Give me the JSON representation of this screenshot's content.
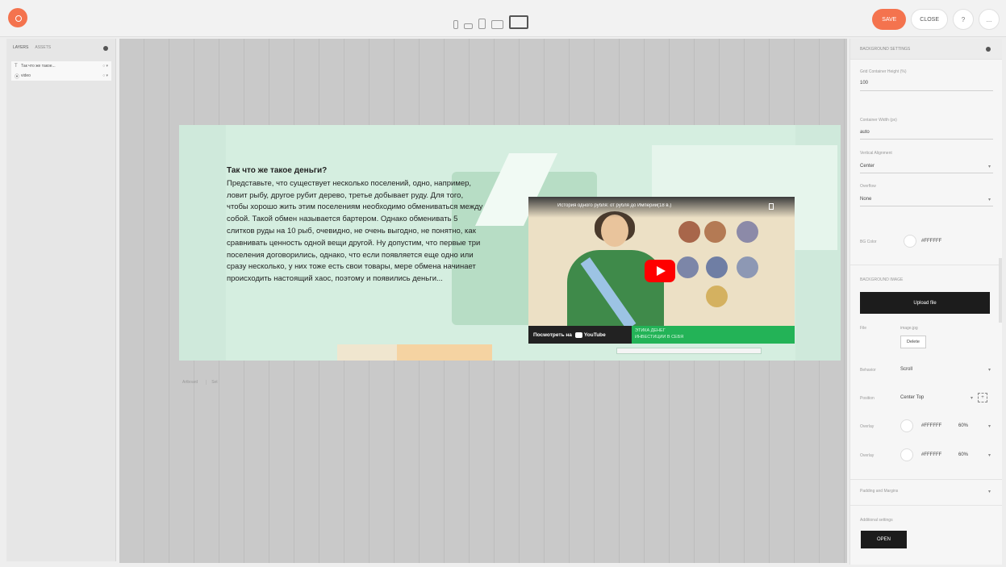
{
  "topbar": {
    "devices": [
      "phone-portrait",
      "phone-landscape",
      "tablet-portrait",
      "tablet-landscape",
      "desktop"
    ],
    "save_label": "SAVE",
    "close_label": "CLOSE",
    "help_label": "?",
    "more_label": "..."
  },
  "left_panel": {
    "tab_layers": "LAYERS",
    "tab_assets": "ASSETS",
    "layers": [
      {
        "icon": "T",
        "name": "Так что же такое...",
        "controls": "○ ▾"
      },
      {
        "icon": "⦿",
        "name": "video",
        "controls": "○ ▾"
      }
    ]
  },
  "artboard": {
    "heading": "Так что же такое деньги?",
    "body": "Представьте, что существует несколько поселений, одно, например, ловит рыбу, другое рубит дерево, третье добывает руду. Для того, чтобы хорошо жить этим поселениям необходимо обмениваться между собой. Такой обмен называется бартером. Однако обменивать 5 слитков руды на 10 рыб, очевидно, не очень выгодно, не понятно, как сравнивать ценность одной вещи другой. Ну допустим, что первые три поселения договорились, однако, что если появляется еще одно или сразу несколько, у них тоже есть свои товары, мере обмена начинает происходить настоящий хаос, поэтому и появились деньги...",
    "coin_symbol": "$",
    "footer_left": "Artboard",
    "footer_right": "Set"
  },
  "video": {
    "title": "История одного рубля: от рубля до Империи(18 в.)",
    "watch_label": "Посмотреть на",
    "youtube_label": "YouTube",
    "band_text_1": "ЭТИКА ДЕНЕГ",
    "band_text_2": "ИНВЕСТИЦИИ В СЕБЯ"
  },
  "right_panel": {
    "header": "BACKGROUND SETTINGS",
    "height_label": "Grid Container Height (%)",
    "height_value": "100",
    "width_label": "Container Width (px)",
    "width_value": "auto",
    "align_label": "Vertical Alignment",
    "align_value": "Center",
    "overflow_label": "Overflow",
    "overflow_value": "None",
    "bg_color_label": "BG Color",
    "bg_color_value": "#FFFFFF",
    "bg_image_label": "BACKGROUND IMAGE",
    "upload_label": "Upload file",
    "file_label": "File",
    "file_value": "image.jpg",
    "delete_label": "Delete",
    "behavior_label": "Behavior",
    "behavior_value": "Scroll",
    "position_label": "Position",
    "position_value": "Center Top",
    "overlay1_label": "Overlay",
    "overlay1_color": "#FFFFFF",
    "overlay1_pct": "60%",
    "overlay2_label": "Overlay",
    "overlay2_color": "#FFFFFF",
    "overlay2_pct": "60%",
    "padding_label": "Padding and Margins",
    "additional_label": "Additional settings",
    "open_label": "OPEN"
  },
  "colors": {
    "accent": "#f4734e",
    "artboard_bg": "#cfe9db",
    "youtube_red": "#ff0000",
    "band_green": "#23b357"
  }
}
